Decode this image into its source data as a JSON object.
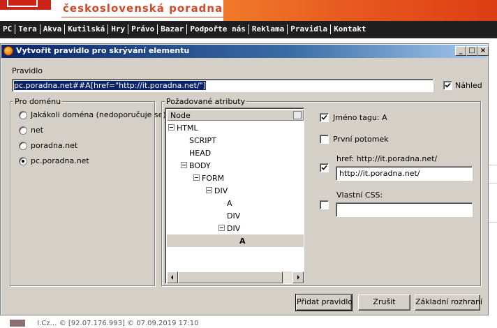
{
  "site": {
    "title": "československá poradna",
    "nav": [
      "PC",
      "Tera",
      "Akva",
      "Kutilská",
      "Hry",
      "Právo",
      "Bazar",
      "Podpořte nás",
      "Reklama",
      "Pravidla",
      "Kontakt"
    ],
    "footer_text": "I.Cz… © [92.07.176.993] © 07.09.2019 17:10"
  },
  "dialog": {
    "title": "Vytvořit pravidlo pro skrývání elementu",
    "rule_label": "Pravidlo",
    "rule_value": "pc.poradna.net##A[href=\"http://it.poradna.net/\"]",
    "preview_label": "Náhled",
    "preview_checked": true,
    "domain_group": {
      "legend": "Pro doménu",
      "options": [
        {
          "label": "Jakákoli doména (nedoporučuje se)",
          "checked": false
        },
        {
          "label": "net",
          "checked": false
        },
        {
          "label": "poradna.net",
          "checked": false
        },
        {
          "label": "pc.poradna.net",
          "checked": true
        }
      ]
    },
    "attr_group": {
      "legend": "Požadované atributy",
      "tree_header": "Node",
      "tree_nodes": [
        {
          "label": "HTML",
          "level": 0,
          "expanded": true,
          "selected": false
        },
        {
          "label": "SCRIPT",
          "level": 1,
          "expanded": false,
          "selected": false
        },
        {
          "label": "HEAD",
          "level": 1,
          "expanded": false,
          "selected": false
        },
        {
          "label": "BODY",
          "level": 1,
          "expanded": true,
          "selected": false
        },
        {
          "label": "FORM",
          "level": 2,
          "expanded": true,
          "selected": false
        },
        {
          "label": "DIV",
          "level": 3,
          "expanded": true,
          "selected": false
        },
        {
          "label": "A",
          "level": 4,
          "expanded": false,
          "selected": false
        },
        {
          "label": "DIV",
          "level": 4,
          "expanded": false,
          "selected": false
        },
        {
          "label": "DIV",
          "level": 4,
          "expanded": true,
          "selected": false
        },
        {
          "label": "A",
          "level": 5,
          "expanded": false,
          "selected": true
        }
      ],
      "tag_name": {
        "label": "Jméno tagu: A",
        "checked": true
      },
      "first_child": {
        "label": "První potomek",
        "checked": false
      },
      "href": {
        "label": "href: http://it.poradna.net/",
        "checked": true,
        "value": "http://it.poradna.net/"
      },
      "custom_css": {
        "label": "Vlastní CSS:",
        "checked": false,
        "value": ""
      }
    },
    "buttons": {
      "add_rule": "Přidat pravidlo",
      "cancel": "Zrušit",
      "basic_view": "Základní rozhraní"
    },
    "window_buttons": {
      "minimize": "_",
      "maximize": "□",
      "close": "×"
    }
  }
}
